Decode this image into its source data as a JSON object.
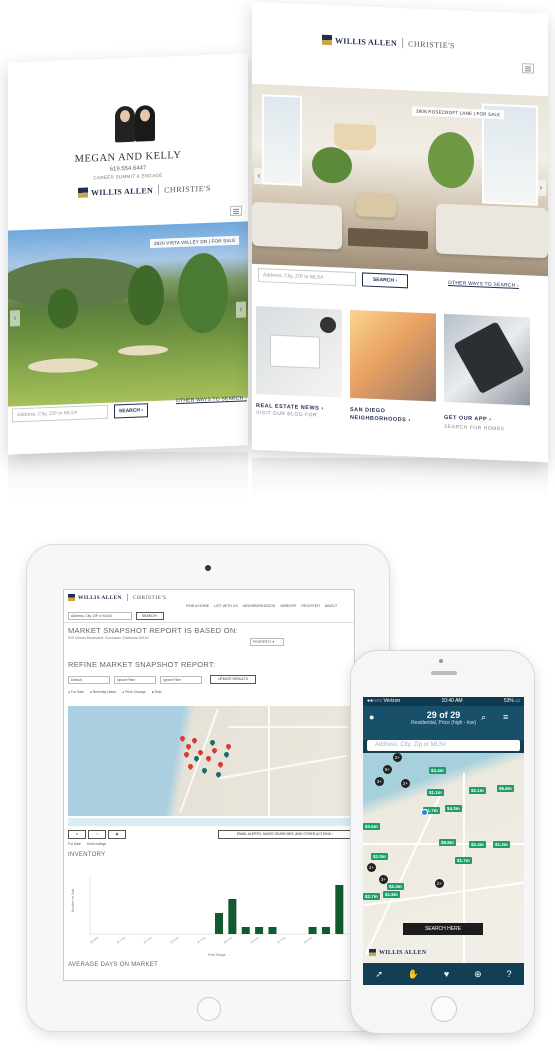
{
  "left_page": {
    "agent_name": "MEGAN AND KELLY",
    "agent_phone": "619.554.6447",
    "agent_title": "CAREER SUMMIT & ENGAGE",
    "brand": "WILLIS ALLEN",
    "brand_partner": "CHRISTIE'S",
    "photo_label": "3920 VISTA VALLEY DR | FOR SALE",
    "search_placeholder": "Address, City, ZIP or MLS#",
    "search_button": "SEARCH ›",
    "other_ways": "OTHER WAYS TO SEARCH ›"
  },
  "right_page": {
    "brand": "WILLIS ALLEN",
    "brand_partner": "CHRISTIE'S",
    "photo_label": "3606 ROSECROFT LANE | FOR SALE",
    "search_placeholder": "Address, City, ZIP or MLS#",
    "search_button": "SEARCH ›",
    "other_ways": "OTHER WAYS TO SEARCH ›",
    "tiles": [
      {
        "title_1": "REAL ESTATE NEWS ›",
        "title_2": "",
        "sub": "VISIT OUR BLOG FOR"
      },
      {
        "title_1": "SAN DIEGO",
        "title_2": "NEIGHBORHOODS ›",
        "sub": ""
      },
      {
        "title_1": "GET OUR APP ›",
        "title_2": "",
        "sub": "SEARCH FOR HOMES"
      }
    ]
  },
  "ipad": {
    "brand": "WILLIS ALLEN",
    "brand_partner": "CHRISTIE'S",
    "nav": [
      "FIND A HOME",
      "LIST WITH US",
      "NEIGHBORHOODS",
      "WEBSITE",
      "REGISTER",
      "ABOUT"
    ],
    "search_placeholder": "Address, City, ZIP or MLS#",
    "search_button": "SEARCH ›",
    "report_title": "MARKET SNAPSHOT REPORT IS BASED ON:",
    "report_address": "915 Ocean Boulevard, Coronado, California 92118",
    "refine_title": "REFINE MARKET SNAPSHOT REPORT:",
    "filters": [
      "Default",
      "Ignore Filter",
      "Ignore Filter"
    ],
    "update_button": "UPDATE RESULTS",
    "legend": [
      "For Sale",
      "Recently Listed",
      "Price Change",
      "Sold"
    ],
    "email_button": "EMAIL ALERTS, SAVED SEARCHES, AND OTHER ACTIONS ›",
    "tabs": [
      "For Sale",
      "Sold Listings"
    ],
    "inventory_title": "INVENTORY",
    "avg_days_title": "AVERAGE DAYS ON MARKET",
    "y_label": "Number for Sale",
    "x_label": "Price Range"
  },
  "iphone": {
    "carrier": "●●○○○ Verizon",
    "time": "10:40 AM",
    "battery": "53% ▭",
    "count": "29 of 29",
    "subtitle": "Residential, Price (high - low)",
    "search_placeholder": "Address, City, Zip or MLS#",
    "search_here": "SEARCH HERE",
    "brand": "WILLIS ALLEN",
    "tab_icons": [
      "nav-arrow-icon",
      "hand-icon",
      "heart-icon",
      "compass-icon",
      "help-icon"
    ],
    "prices": [
      "$3.4m",
      "$5.8m",
      "$2.1m",
      "$1.1m",
      "$4.3m",
      "$1.7m",
      "$3.6m",
      "$8.8m",
      "$2.4m",
      "$1.3m",
      "$2.0m",
      "$1.7m",
      "$2.4m",
      "$2.7m",
      "$1.8m"
    ],
    "clusters": [
      "2+",
      "5+",
      "3+",
      "2+",
      "2+",
      "3+",
      "2+"
    ]
  },
  "chart_data": {
    "type": "bar",
    "title": "INVENTORY",
    "xlabel": "Price Range",
    "ylabel": "Number for Sale",
    "categories": [
      "$0-500k",
      "$500k-1m",
      "$1-1.5m",
      "$1.5-2m",
      "$2-2.5m",
      "$2.5-3m",
      "$3-3.5m",
      "$3.5-4m",
      "$4-4.5m",
      "$4.5-5m",
      "$5-5.5m",
      "$5.5-6m",
      "$6-6.5m",
      "$6.5-7m",
      "$7-7.5m",
      "$7.5-8m",
      "$8-8.5m",
      "$8.5m+"
    ],
    "values": [
      0,
      0,
      0,
      0,
      0,
      0,
      0,
      0,
      0,
      3,
      5,
      1,
      1,
      1,
      0,
      0,
      1,
      1,
      7
    ],
    "ylim": [
      0,
      8
    ],
    "color": "#0f5a2e"
  }
}
